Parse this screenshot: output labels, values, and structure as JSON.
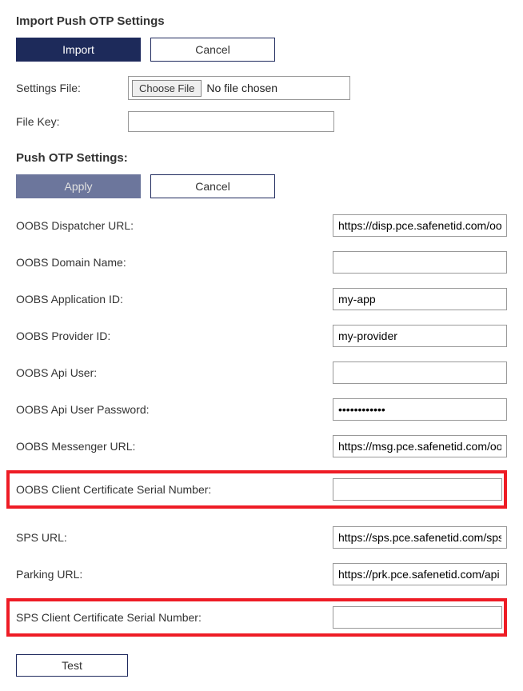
{
  "import_section": {
    "title": "Import Push OTP Settings",
    "import_btn": "Import",
    "cancel_btn": "Cancel",
    "settings_file_label": "Settings File:",
    "choose_file_btn": "Choose File",
    "no_file_text": "No file chosen",
    "file_key_label": "File Key:",
    "file_key_value": ""
  },
  "settings_section": {
    "title": "Push OTP Settings:",
    "apply_btn": "Apply",
    "cancel_btn": "Cancel",
    "fields": {
      "dispatcher_url": {
        "label": "OOBS Dispatcher URL:",
        "value": "https://disp.pce.safenetid.com/oobs"
      },
      "domain_name": {
        "label": "OOBS Domain Name:",
        "value": ""
      },
      "application_id": {
        "label": "OOBS Application ID:",
        "value": "my-app"
      },
      "provider_id": {
        "label": "OOBS Provider ID:",
        "value": "my-provider"
      },
      "api_user": {
        "label": "OOBS Api User:",
        "value": ""
      },
      "api_user_password": {
        "label": "OOBS Api User Password:",
        "value": "••••••••••••"
      },
      "messenger_url": {
        "label": "OOBS Messenger URL:",
        "value": "https://msg.pce.safenetid.com/oobs"
      },
      "oobs_cert_serial": {
        "label": "OOBS Client Certificate Serial Number:",
        "value": ""
      },
      "sps_url": {
        "label": "SPS URL:",
        "value": "https://sps.pce.safenetid.com/sps"
      },
      "parking_url": {
        "label": "Parking URL:",
        "value": "https://prk.pce.safenetid.com/api"
      },
      "sps_cert_serial": {
        "label": "SPS Client Certificate Serial Number:",
        "value": ""
      }
    },
    "test_btn": "Test"
  }
}
